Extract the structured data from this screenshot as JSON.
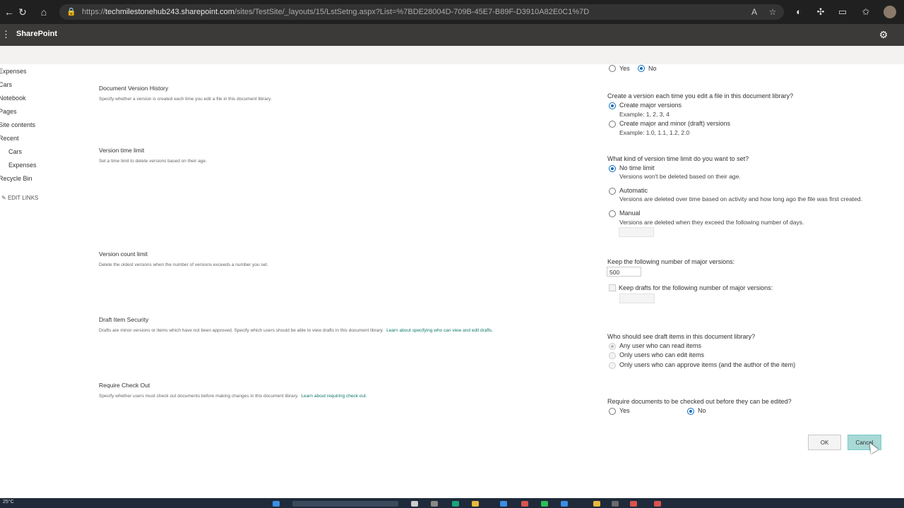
{
  "browser": {
    "url_prefix": "https://",
    "url_host": "techmilestonehub243.sharepoint.com",
    "url_path": "/sites/TestSite/_layouts/15/LstSetng.aspx?List=%7BDE28004D-709B-45E7-B89F-D3910A82E0C1%7D"
  },
  "suite": {
    "brand": "SharePoint"
  },
  "leftnav": {
    "items": [
      "Expenses",
      "Cars",
      "Notebook",
      "Pages",
      "Site contents",
      "Recent",
      "Cars",
      "Expenses",
      "Recycle Bin"
    ],
    "edit_links": "EDIT LINKS"
  },
  "top_partial": {
    "yes": "Yes",
    "no": "No",
    "selected": "No"
  },
  "version_history": {
    "title": "Document Version History",
    "desc": "Specify whether a version is created each time you edit a file in this document library.",
    "question": "Create a version each time you edit a file in this document library?",
    "opt_major": "Create major versions",
    "opt_major_example": "Example: 1, 2, 3, 4",
    "opt_minor": "Create major and minor (draft) versions",
    "opt_minor_example": "Example: 1.0, 1.1, 1.2, 2.0",
    "selected": "Create major versions"
  },
  "time_limit": {
    "title": "Version time limit",
    "desc": "Set a time limit to delete versions based on their age.",
    "question": "What kind of version time limit do you want to set?",
    "opt_none": "No time limit",
    "opt_none_desc": "Versions won't be deleted based on their age.",
    "opt_auto": "Automatic",
    "opt_auto_desc": "Versions are deleted over time based on activity and how long ago the file was first created.",
    "opt_manual": "Manual",
    "opt_manual_desc": "Versions are deleted when they exceed the following number of days.",
    "days_value": "",
    "selected": "No time limit"
  },
  "count_limit": {
    "title": "Version count limit",
    "desc": "Delete the oldest versions when the number of versions exceeds a number you set.",
    "major_label": "Keep the following number of major versions:",
    "major_value": "500",
    "drafts_label": "Keep drafts for the following number of major versions:",
    "drafts_value": ""
  },
  "draft_security": {
    "title": "Draft Item Security",
    "desc": "Drafts are minor versions or items which have not been approved. Specify which users should be able to view drafts in this document library.",
    "link": "Learn about specifying who can view and edit drafts.",
    "question": "Who should see draft items in this document library?",
    "opt_read": "Any user who can read items",
    "opt_edit": "Only users who can edit items",
    "opt_approve": "Only users who can approve items (and the author of the item)",
    "selected": "Any user who can read items"
  },
  "checkout": {
    "title": "Require Check Out",
    "desc": "Specify whether users must check out documents before making changes in this document library.",
    "link": "Learn about requiring check out.",
    "question": "Require documents to be checked out before they can be edited?",
    "yes": "Yes",
    "no": "No",
    "selected": "No"
  },
  "buttons": {
    "ok": "OK",
    "cancel": "Cancel"
  },
  "taskbar": {
    "weather": "25°C"
  },
  "colors": {
    "accent": "#0f6cbd",
    "link": "#0f7a6d",
    "suite_bar": "#3b3a39",
    "cancel_bg": "#a8d9d6"
  }
}
